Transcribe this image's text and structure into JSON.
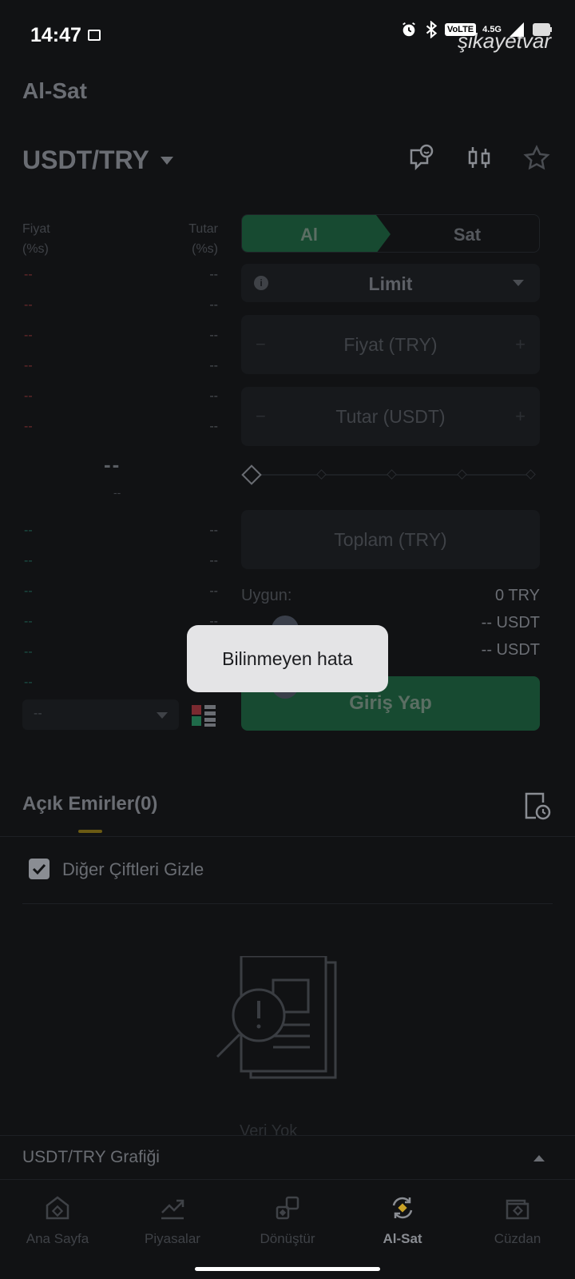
{
  "status_bar": {
    "time": "14:47",
    "volte": "VoLTE",
    "network": "4.5G",
    "watermark": "şikayetvar"
  },
  "page_title": "Al-Sat",
  "pair": {
    "label": "USDT/TRY"
  },
  "order_book": {
    "price_header_line1": "Fiyat",
    "price_header_line2": "(%s)",
    "amount_header_line1": "Tutar",
    "amount_header_line2": "(%s)",
    "placeholder": "--",
    "mid_price": "--",
    "mid_sub": "--",
    "depth_value": "--"
  },
  "trade_form": {
    "buy_tab": "Al",
    "sell_tab": "Sat",
    "order_type": "Limit",
    "price_placeholder": "Fiyat (TRY)",
    "amount_placeholder": "Tutar (USDT)",
    "total_placeholder": "Toplam (TRY)",
    "available_label": "Uygun:",
    "available_value": "0 TRY",
    "row2_value": "-- USDT",
    "row3_value": "-- USDT",
    "login_button": "Giriş Yap",
    "minus": "−",
    "plus": "+"
  },
  "toast": {
    "message": "Bilinmeyen hata"
  },
  "open_orders": {
    "title": "Açık Emirler(0)",
    "hide_other_pairs": "Diğer Çiftleri Gizle",
    "empty_text": "Veri Yok"
  },
  "chart_bar": {
    "label": "USDT/TRY Grafiği"
  },
  "bottom_nav": {
    "items": [
      {
        "label": "Ana Sayfa",
        "icon": "home-icon"
      },
      {
        "label": "Piyasalar",
        "icon": "markets-icon"
      },
      {
        "label": "Dönüştür",
        "icon": "convert-icon"
      },
      {
        "label": "Al-Sat",
        "icon": "trade-icon",
        "active": true
      },
      {
        "label": "Cüzdan",
        "icon": "wallet-icon"
      }
    ]
  },
  "colors": {
    "background": "#111214",
    "buy_green": "#174a31",
    "accent_gold": "#c9a227",
    "ask_red": "#6b2a2c",
    "bid_green": "#1b5147"
  }
}
